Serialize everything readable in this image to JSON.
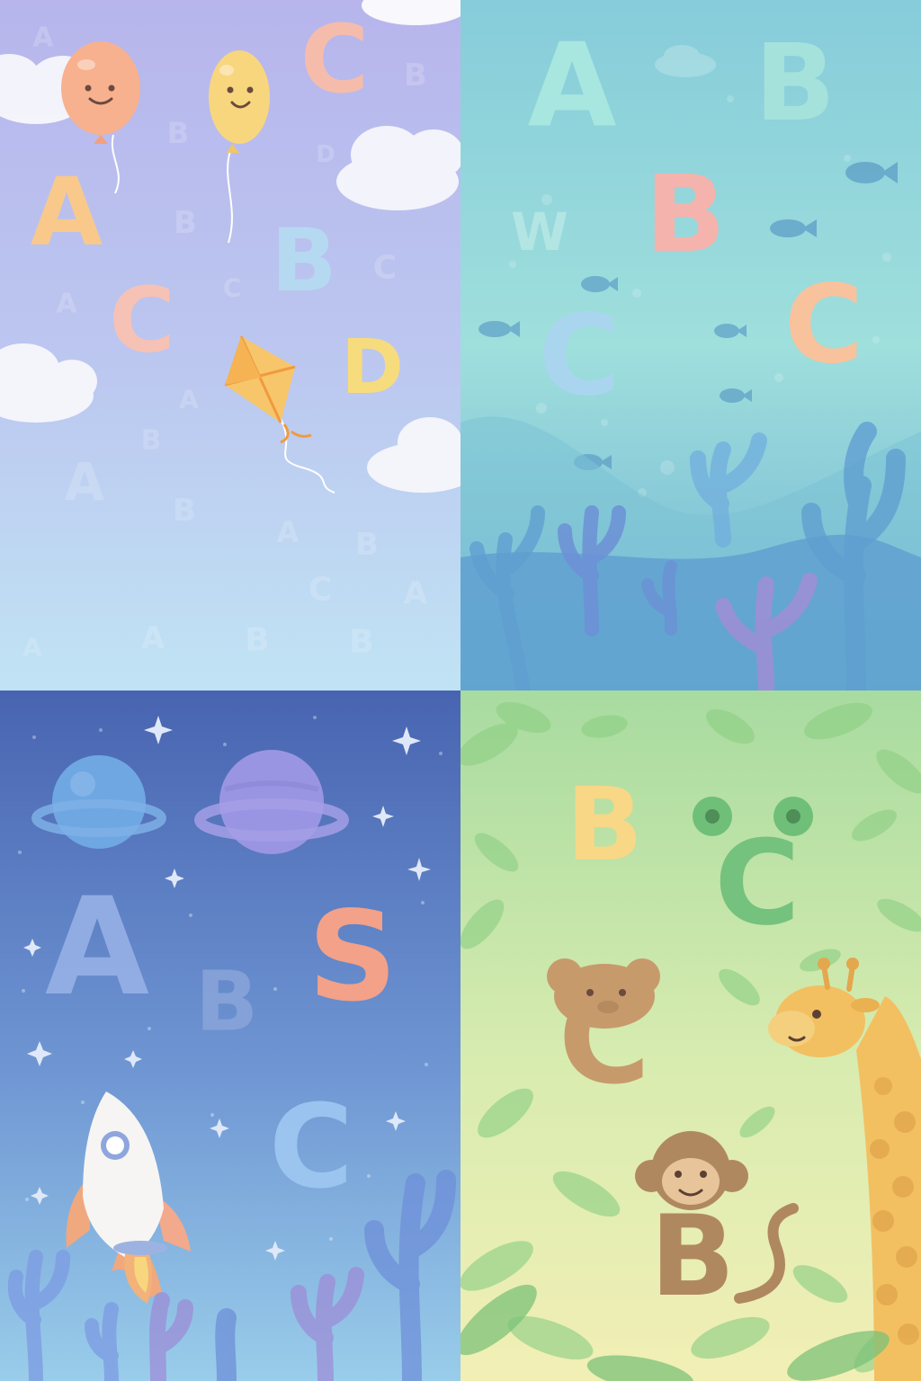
{
  "panels": [
    {
      "id": "sky",
      "theme": "sky",
      "colors": {
        "top": "#b9b7ec",
        "bottom": "#bfe2f3"
      },
      "letters": [
        "C",
        "A",
        "B",
        "C",
        "D"
      ],
      "letter_colors": [
        "#f6b9a8",
        "#f8c98b",
        "#b6d9f2",
        "#f6c2b5",
        "#f7dc7d"
      ],
      "background_letters": [
        "A",
        "B",
        "C",
        "D",
        "A",
        "B",
        "C",
        "A",
        "B",
        "C",
        "A",
        "B",
        "C",
        "A",
        "B",
        "C",
        "B",
        "A"
      ],
      "icons": [
        "balloon-icon",
        "balloon-icon",
        "kite-icon",
        "cloud-icon"
      ]
    },
    {
      "id": "sea",
      "theme": "underwater",
      "colors": {
        "top": "#84cfdc",
        "bottom": "#5a9fcf"
      },
      "letters": [
        "A",
        "B",
        "B",
        "C",
        "C",
        "W"
      ],
      "letter_colors": [
        "#a7e7df",
        "#a5e2dc",
        "#f5b3ae",
        "#a9d6ee",
        "#f8c29d",
        "#c9f0ea"
      ],
      "icons": [
        "fish-icon",
        "seaweed-icon",
        "coral-icon",
        "bubble-icon"
      ]
    },
    {
      "id": "space",
      "theme": "space",
      "colors": {
        "top": "#4a66b3",
        "bottom": "#8ec3e6"
      },
      "letters": [
        "A",
        "B",
        "S",
        "C"
      ],
      "letter_colors": [
        "#96b1e6",
        "#8ea8dc",
        "#f3a188",
        "#9fc8f2"
      ],
      "icons": [
        "planet-icon",
        "planet-icon",
        "rocket-icon",
        "star-icon",
        "coral-icon"
      ]
    },
    {
      "id": "jungle",
      "theme": "jungle",
      "colors": {
        "top": "#a9dba0",
        "bottom": "#f2efb3"
      },
      "letters": [
        "B",
        "C",
        "C",
        "B"
      ],
      "letter_colors": [
        "#f8d786",
        "#74c27d",
        "#c79a6b",
        "#b08860"
      ],
      "icons": [
        "frog-icon",
        "bear-icon",
        "monkey-icon",
        "giraffe-icon",
        "leaf-icon"
      ]
    }
  ]
}
